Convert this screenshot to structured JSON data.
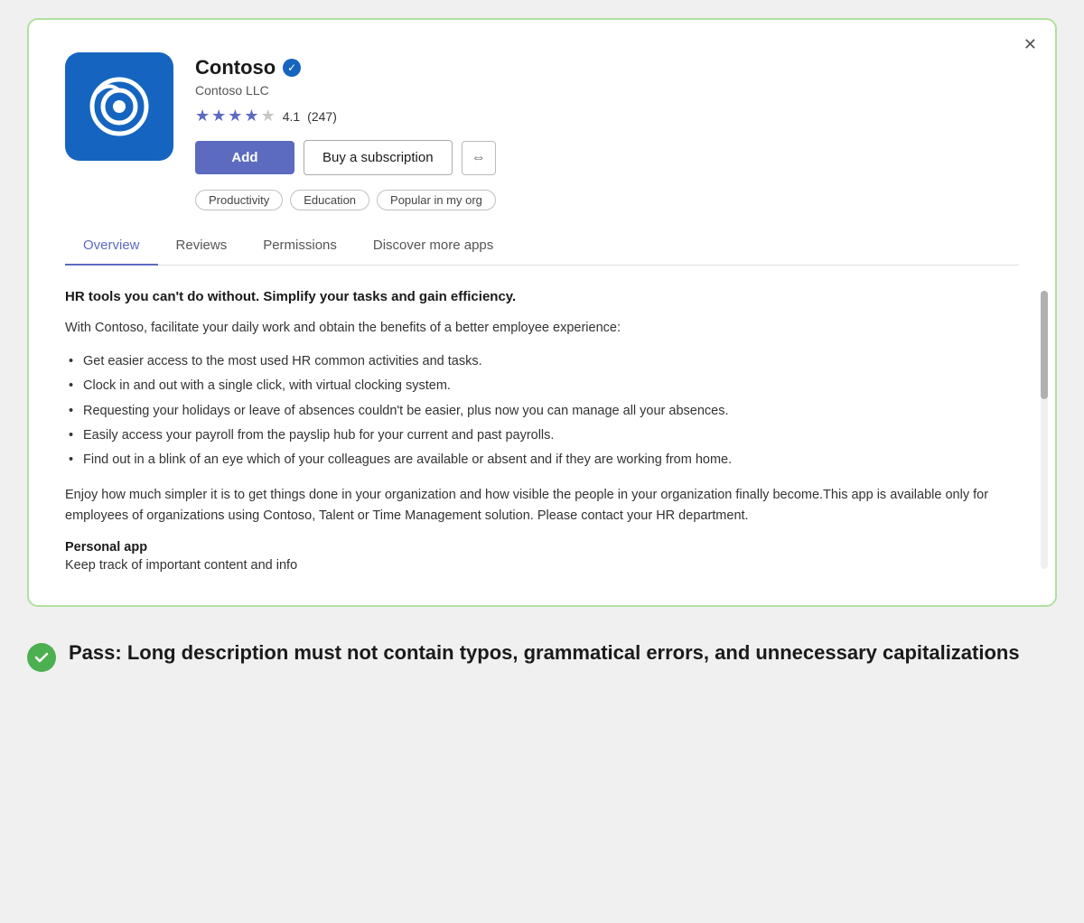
{
  "card": {
    "app_name": "Contoso",
    "publisher": "Contoso LLC",
    "rating_value": "4.1",
    "rating_count": "(247)",
    "stars": [
      "full",
      "full",
      "full",
      "half",
      "empty"
    ],
    "add_button": "Add",
    "subscribe_button": "Buy a subscription",
    "tags": [
      "Productivity",
      "Education",
      "Popular in my org"
    ],
    "tabs": [
      {
        "label": "Overview",
        "active": true
      },
      {
        "label": "Reviews",
        "active": false
      },
      {
        "label": "Permissions",
        "active": false
      },
      {
        "label": "Discover more apps",
        "active": false
      }
    ],
    "headline": "HR tools you can't do without. Simplify your tasks and gain efficiency.",
    "intro": "With Contoso, facilitate your daily work and obtain the benefits of a better employee experience:",
    "list_items": [
      "Get easier access to the most used HR common activities and tasks.",
      "Clock in and out with a single click, with virtual clocking system.",
      "Requesting your holidays or leave of absences couldn't be easier, plus now you can manage all your absences.",
      "Easily access your payroll from the payslip hub for your current and past payrolls.",
      "Find out in a blink of an eye which of your colleagues are available or absent and if they are working from home."
    ],
    "body_text": "Enjoy how much simpler it is to get things done in your organization and how visible the people in your organization finally become.This app is available only for employees of organizations using Contoso, Talent or Time Management solution. Please contact your HR department.",
    "personal_app_title": "Personal app",
    "personal_app_desc": "Keep track of important content and info"
  },
  "pass_result": {
    "label": "Pass: Long description must not contain typos, grammatical errors, and unnecessary capitalizations"
  }
}
